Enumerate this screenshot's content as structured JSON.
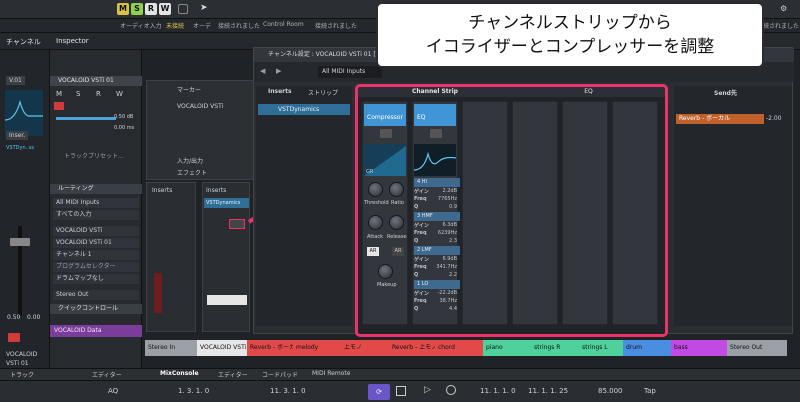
{
  "toolbar": {
    "mode_buttons": [
      "M",
      "S",
      "R",
      "W"
    ],
    "mode_colors": [
      "#d7c246",
      "#8fd14f",
      "#e3e3e3",
      "#e3e3e3"
    ],
    "sub_items": [
      "オーディオ入力",
      "未接続",
      "オーデ",
      "接続されました",
      "Control Room",
      "接続されました",
      "予約接続されました"
    ]
  },
  "callout": {
    "line1": "チャンネルストリップから",
    "line2": "イコライザーとコンプレッサーを調整"
  },
  "left_col": {
    "title": "チャンネル",
    "version": "V.01",
    "inserts": "Inser.",
    "insert_slot": "VSTDyn..ss",
    "fader_vals": [
      "0.50",
      "0.00"
    ],
    "track_name_1": "VOCALOID",
    "track_name_2": "VSTi 01",
    "tab": "トラック"
  },
  "inspector": {
    "title": "Inspector",
    "track_name": "VOCALOID VSTi 01",
    "ms": [
      "M",
      "S",
      "R",
      "W"
    ],
    "vol_value": "0.50 dB",
    "pan_value": "0.00 ms",
    "preset": "トラックプリセット...",
    "routing_label": "ルーティング",
    "routing_in": "All MIDI Inputs",
    "routing_ch": "すべての入力",
    "out_1": "VOCALOID VSTi",
    "out_2": "VOCALOID VSTi 01",
    "out_ch": "チャンネル 1",
    "program_selector": "プログラムセレクター",
    "drum_map": "ドラムマップなし",
    "stereo_out": "Stereo Out",
    "quick_control": "クイックコントロール",
    "footer_name": "VOCALOID Data",
    "tab_editor": "エディター"
  },
  "tracks": {
    "marker": "マーカー",
    "track_label": "VOCALOID VSTi",
    "io": "入力/出力",
    "effect": "エフェクト",
    "inserts_label": "Inserts",
    "inserts_label2": "Inserts",
    "insert_slot": "VSTDynamics"
  },
  "channel_settings": {
    "title": "チャンネル設定 : VOCALOID VSTi 01 [ステレ",
    "midi_input": "All MIDI Inputs",
    "inserts_tab": "Inserts",
    "strip_tab": "ストリップ",
    "insert_item": "VSTDynamics",
    "channel_strip_header": "Channel Strip",
    "eq_header": "EQ",
    "sends_header": "Send先",
    "send_item": "Reverb - ボーカル",
    "send_value": "-2.00",
    "compressor_label": "Compressor",
    "eq_label": "EQ",
    "gr_label": "GR",
    "knob_labels": [
      "Threshold",
      "Ratio",
      "Attack",
      "Release",
      "Makeup"
    ],
    "auto_labels": [
      "AR",
      "AR"
    ],
    "eq_bands": [
      {
        "name": "4 HI",
        "gain": "2.2dB",
        "freq": "7765Hz",
        "q": "0.9"
      },
      {
        "name": "3 HMF",
        "gain": "6.3dB",
        "freq": "6239Hz",
        "q": "2.3"
      },
      {
        "name": "2 LMF",
        "gain": "6.9dB",
        "freq": "341.7Hz",
        "q": "2.2"
      },
      {
        "name": "1 LO",
        "gain": "-22.2dB",
        "freq": "38.7Hz",
        "q": "4.4"
      }
    ],
    "row_labels": [
      "ゲイン",
      "Freq",
      "Q"
    ]
  },
  "track_colors": [
    {
      "name": "Stereo In",
      "color": "#9aa0a6"
    },
    {
      "name": "VOCALOID VSTi 01",
      "color": "#e6e6e6"
    },
    {
      "name": "Reverb - ボーカル",
      "color": "#e24a4a"
    },
    {
      "name": "melody",
      "color": "#e24a4a"
    },
    {
      "name": "上モノ",
      "color": "#e24a4a"
    },
    {
      "name": "Reverb - 上モノ",
      "color": "#e24a4a"
    },
    {
      "name": "chord",
      "color": "#e24a4a"
    },
    {
      "name": "piano",
      "color": "#4ed19a"
    },
    {
      "name": "strings R",
      "color": "#4ed19a"
    },
    {
      "name": "strings L",
      "color": "#4ed19a"
    },
    {
      "name": "drum",
      "color": "#4a8ee2"
    },
    {
      "name": "bass",
      "color": "#c04ae2"
    },
    {
      "name": "Stereo Out",
      "color": "#9aa0a6"
    }
  ],
  "bottom_tabs": [
    "MixConsole",
    "エディター",
    "コードパッド",
    "MIDI Remote"
  ],
  "transport": {
    "pos_left": "1. 3. 1. 0",
    "pos_mid": "11. 3. 1. 0",
    "pos_right": "11. 1. 1. 0",
    "pos_end": "11. 1. 1. 25",
    "tempo": "85.000",
    "tap": "Tap",
    "aq": "AQ"
  }
}
